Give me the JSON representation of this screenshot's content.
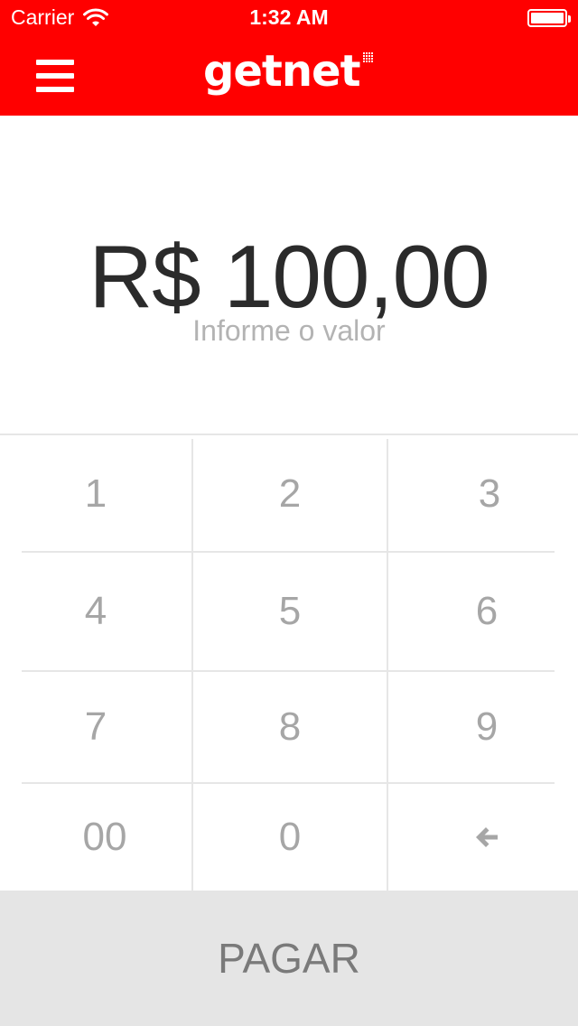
{
  "status_bar": {
    "carrier": "Carrier",
    "time": "1:32 AM"
  },
  "header": {
    "brand": "getnet",
    "brand_color": "#ff0000"
  },
  "amount": {
    "value": "R$ 100,00",
    "hint": "Informe o valor"
  },
  "keypad": {
    "keys": [
      "1",
      "2",
      "3",
      "4",
      "5",
      "6",
      "7",
      "8",
      "9",
      "00",
      "0"
    ],
    "backspace_icon": "arrow-left-icon"
  },
  "footer": {
    "pay_label": "PAGAR"
  }
}
